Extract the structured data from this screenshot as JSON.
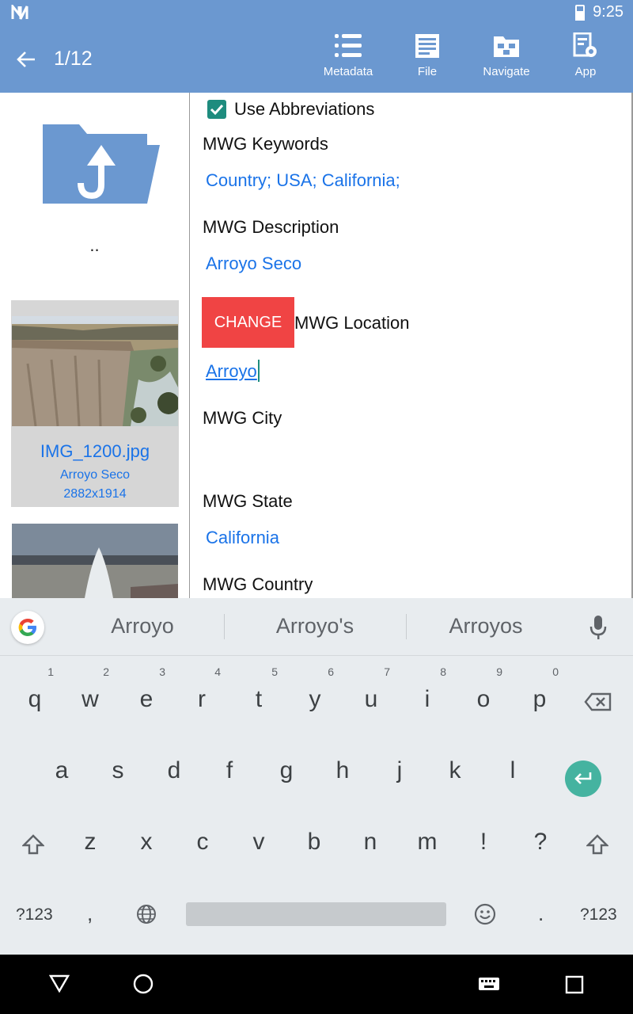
{
  "status": {
    "time": "9:25"
  },
  "header": {
    "counter": "1/12",
    "tools": [
      {
        "label": "Metadata",
        "icon": "list-icon"
      },
      {
        "label": "File",
        "icon": "document-icon"
      },
      {
        "label": "Navigate",
        "icon": "folder-move-icon"
      },
      {
        "label": "App",
        "icon": "settings-icon"
      }
    ]
  },
  "sidebar": {
    "parent_label": "..",
    "items": [
      {
        "filename": "IMG_1200.jpg",
        "description": "Arroyo Seco",
        "dimensions": "2882x1914"
      }
    ]
  },
  "form": {
    "use_abbreviations_label": "Use Abbreviations",
    "use_abbreviations_checked": true,
    "keywords_label": "MWG Keywords",
    "keywords_value": "Country; USA; California;",
    "description_label": "MWG Description",
    "description_value": "Arroyo Seco",
    "change_button": "CHANGE",
    "location_label": "MWG Location",
    "location_value": "Arroyo",
    "city_label": "MWG City",
    "city_value": "",
    "state_label": "MWG State",
    "state_value": "California",
    "country_label": "MWG Country"
  },
  "keyboard": {
    "suggestions": [
      "Arroyo",
      "Arroyo's",
      "Arroyos"
    ],
    "row1": [
      {
        "k": "q",
        "n": "1"
      },
      {
        "k": "w",
        "n": "2"
      },
      {
        "k": "e",
        "n": "3"
      },
      {
        "k": "r",
        "n": "4"
      },
      {
        "k": "t",
        "n": "5"
      },
      {
        "k": "y",
        "n": "6"
      },
      {
        "k": "u",
        "n": "7"
      },
      {
        "k": "i",
        "n": "8"
      },
      {
        "k": "o",
        "n": "9"
      },
      {
        "k": "p",
        "n": "0"
      }
    ],
    "row2": [
      "a",
      "s",
      "d",
      "f",
      "g",
      "h",
      "j",
      "k",
      "l"
    ],
    "row3": [
      "z",
      "x",
      "c",
      "v",
      "b",
      "n",
      "m",
      "!",
      "?"
    ],
    "symbols_label": "?123",
    "comma": ",",
    "period": "."
  },
  "colors": {
    "appbar": "#6b98d0",
    "accent": "#1a73e8",
    "change": "#f04444",
    "teal": "#1e8c7e"
  }
}
